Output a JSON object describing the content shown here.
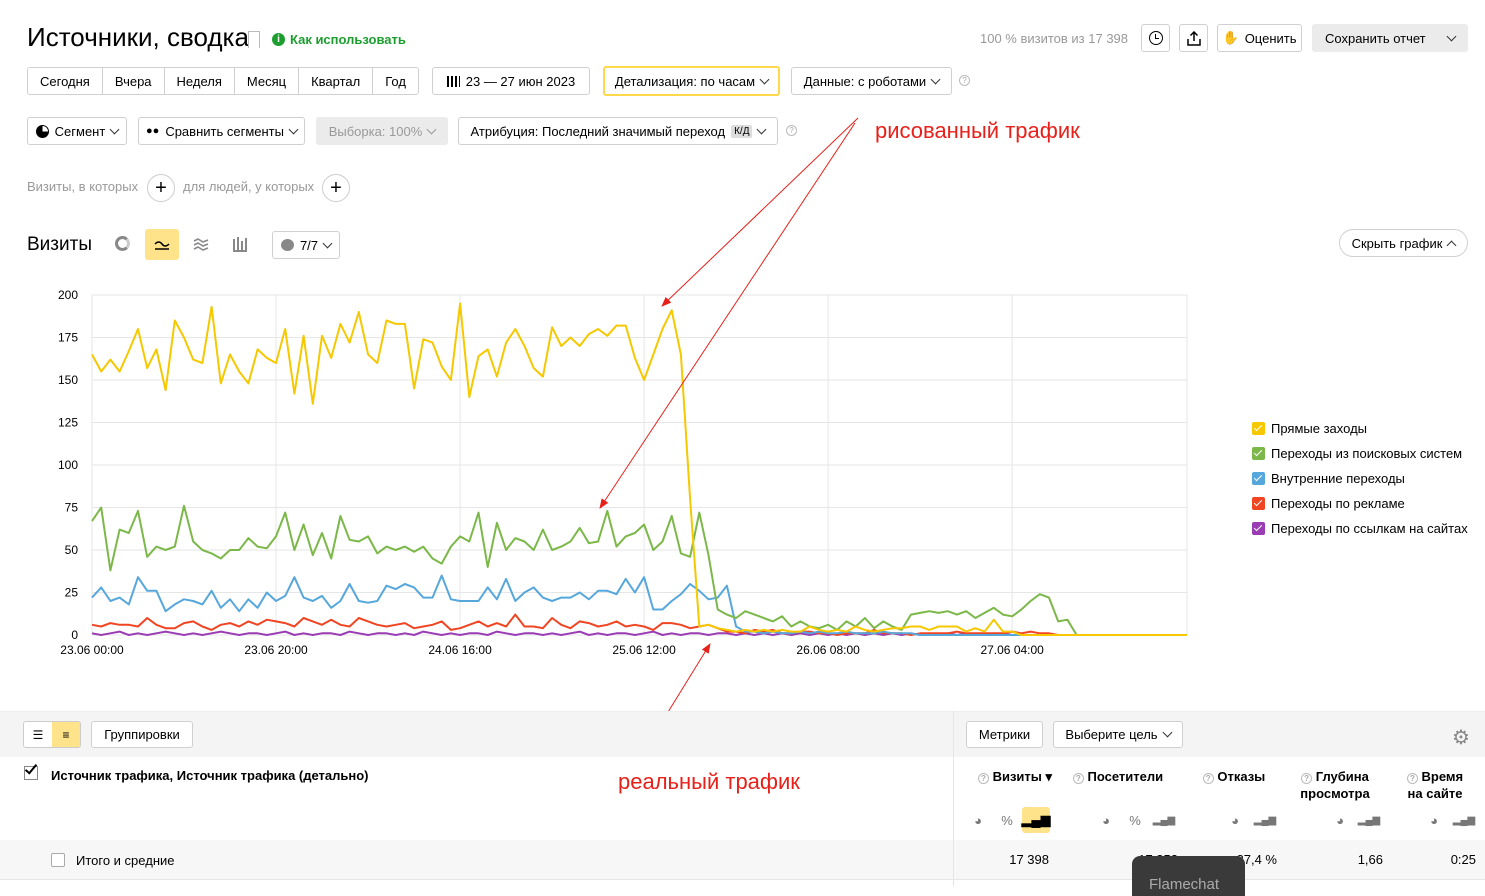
{
  "header": {
    "title": "Источники, сводка",
    "how_to": "Как использовать",
    "visits_info": "100 % визитов из 17 398",
    "rate_label": "Оценить",
    "save_label": "Сохранить отчет"
  },
  "periods": [
    "Сегодня",
    "Вчера",
    "Неделя",
    "Месяц",
    "Квартал",
    "Год"
  ],
  "date_range": "23 — 27 июн 2023",
  "detail": "Детализация: по часам",
  "data_mode": "Данные: с роботами",
  "segment": "Сегмент",
  "compare": "Сравнить сегменты",
  "sample": "Выборка: 100%",
  "attribution": "Атрибуция: Последний значимый переход",
  "attribution_badge": "К/Д",
  "filter": {
    "visits": "Визиты, в которых",
    "people": "для людей, у которых"
  },
  "chart_header": {
    "title": "Визиты",
    "counter": "7/7",
    "hide": "Скрыть график"
  },
  "annotations": {
    "drawn": "рисованный трафик",
    "real": "реальный трафик"
  },
  "chart_data": {
    "type": "line",
    "ylim": [
      0,
      200
    ],
    "yticks": [
      "200",
      "175",
      "150",
      "125",
      "100",
      "75",
      "50",
      "25",
      "0"
    ],
    "xticks": [
      "23.06 00:00",
      "23.06 20:00",
      "24.06 16:00",
      "25.06 12:00",
      "26.06 08:00",
      "27.06 04:00"
    ],
    "x_unit": "hours from 23.06 00:00",
    "xlim": [
      0,
      119
    ],
    "series": [
      {
        "name": "Прямые заходы",
        "color": "#f5c800",
        "values": [
          165,
          155,
          162,
          155,
          167,
          180,
          157,
          168,
          144,
          185,
          175,
          162,
          160,
          193,
          148,
          165,
          155,
          148,
          168,
          163,
          160,
          180,
          142,
          176,
          136,
          176,
          163,
          183,
          172,
          190,
          165,
          160,
          185,
          183,
          183,
          145,
          174,
          172,
          158,
          150,
          195,
          140,
          164,
          168,
          152,
          172,
          180,
          170,
          157,
          152,
          181,
          170,
          175,
          170,
          177,
          180,
          176,
          182,
          182,
          163,
          150,
          165,
          180,
          191,
          165,
          80,
          5,
          6,
          4,
          3,
          2,
          3,
          2,
          3,
          2,
          3,
          2,
          2,
          5,
          3,
          2,
          3,
          2,
          5,
          3,
          2,
          3,
          4,
          4,
          5,
          5,
          3,
          5,
          5,
          5,
          2,
          4,
          2,
          9,
          2,
          2,
          0,
          0,
          0,
          0,
          0,
          0,
          0,
          0,
          0,
          0,
          0,
          0,
          0,
          0,
          0,
          0,
          0,
          0,
          0
        ]
      },
      {
        "name": "Переходы из поисковых систем",
        "color": "#7cb849",
        "values": [
          67,
          75,
          38,
          62,
          60,
          73,
          46,
          52,
          50,
          52,
          76,
          55,
          50,
          48,
          45,
          50,
          50,
          57,
          52,
          51,
          58,
          72,
          50,
          65,
          47,
          60,
          45,
          70,
          56,
          55,
          58,
          48,
          52,
          50,
          52,
          49,
          52,
          45,
          42,
          52,
          58,
          55,
          72,
          40,
          66,
          50,
          57,
          55,
          50,
          62,
          50,
          52,
          55,
          63,
          54,
          55,
          73,
          52,
          58,
          60,
          65,
          50,
          55,
          70,
          48,
          46,
          72,
          47,
          15,
          12,
          10,
          14,
          12,
          10,
          8,
          11,
          5,
          8,
          5,
          4,
          6,
          3,
          8,
          5,
          10,
          4,
          8,
          5,
          3,
          12,
          13,
          14,
          13,
          14,
          12,
          14,
          10,
          13,
          16,
          12,
          11,
          15,
          20,
          24,
          22,
          8,
          9,
          0,
          0,
          0,
          0,
          0,
          0,
          0,
          0,
          0,
          0,
          0,
          0,
          0
        ]
      },
      {
        "name": "Внутренние переходы",
        "color": "#56a7dc",
        "values": [
          22,
          28,
          20,
          22,
          18,
          34,
          26,
          26,
          14,
          18,
          21,
          20,
          18,
          26,
          16,
          21,
          14,
          21,
          16,
          25,
          20,
          23,
          34,
          22,
          20,
          23,
          16,
          20,
          30,
          20,
          19,
          20,
          29,
          27,
          30,
          28,
          22,
          22,
          35,
          21,
          20,
          20,
          20,
          28,
          21,
          33,
          20,
          25,
          28,
          22,
          20,
          22,
          22,
          25,
          21,
          26,
          26,
          24,
          33,
          25,
          34,
          15,
          15,
          20,
          24,
          30,
          26,
          21,
          22,
          29,
          5,
          2,
          2,
          1,
          2,
          1,
          1,
          2,
          1,
          2,
          1,
          1,
          2,
          1,
          1,
          1,
          2,
          1,
          1,
          1,
          0,
          0,
          0,
          0,
          0,
          0,
          0,
          0,
          0,
          0,
          0,
          0,
          0,
          0,
          0,
          0,
          0,
          0,
          0,
          0,
          0,
          0,
          0,
          0,
          0,
          0,
          0,
          0,
          0,
          0
        ]
      },
      {
        "name": "Переходы по рекламе",
        "color": "#f04523",
        "values": [
          6,
          5,
          7,
          6,
          6,
          5,
          10,
          6,
          4,
          4,
          7,
          8,
          5,
          3,
          6,
          7,
          5,
          8,
          6,
          9,
          8,
          7,
          5,
          10,
          8,
          6,
          9,
          6,
          5,
          10,
          8,
          6,
          5,
          6,
          7,
          4,
          5,
          6,
          8,
          3,
          4,
          6,
          8,
          5,
          7,
          5,
          12,
          5,
          5,
          4,
          10,
          6,
          4,
          8,
          7,
          5,
          6,
          8,
          5,
          6,
          5,
          3,
          7,
          7,
          6,
          4,
          5,
          6,
          4,
          2,
          2,
          1,
          3,
          2,
          3,
          1,
          1,
          2,
          2,
          1,
          1,
          0,
          1,
          1,
          1,
          3,
          1,
          1,
          1,
          0,
          1,
          1,
          1,
          1,
          2,
          1,
          1,
          1,
          1,
          1,
          2,
          1,
          2,
          1,
          1,
          0,
          0,
          0,
          0,
          0,
          0,
          0,
          0,
          0,
          0,
          0,
          0,
          0,
          0,
          0
        ]
      },
      {
        "name": "Переходы по ссылкам на сайтах",
        "color": "#9a3cb4",
        "values": [
          1,
          0,
          1,
          2,
          0,
          1,
          0,
          1,
          2,
          1,
          0,
          1,
          0,
          1,
          2,
          1,
          0,
          1,
          1,
          0,
          1,
          2,
          0,
          1,
          0,
          1,
          1,
          0,
          2,
          1,
          0,
          1,
          1,
          0,
          1,
          0,
          2,
          1,
          0,
          1,
          0,
          1,
          1,
          0,
          2,
          1,
          0,
          1,
          1,
          0,
          1,
          0,
          1,
          2,
          0,
          1,
          0,
          1,
          1,
          0,
          1,
          2,
          0,
          1,
          0,
          1,
          1,
          0,
          1,
          1,
          0,
          1,
          0,
          1,
          0,
          1,
          0,
          1,
          0,
          1,
          0,
          1,
          0,
          1,
          0,
          1,
          0,
          1,
          0,
          1,
          0,
          1,
          0,
          1,
          0,
          1,
          0,
          1,
          0,
          1,
          0,
          0,
          0,
          0,
          0,
          0,
          0,
          0,
          0,
          0,
          0,
          0,
          0,
          0,
          0,
          0,
          0,
          0,
          0,
          0
        ]
      }
    ]
  },
  "table": {
    "groupings": "Группировки",
    "metrics": "Метрики",
    "goal": "Выберите цель",
    "dimension": "Источник трафика, Источник трафика (детально)",
    "columns": [
      "Визиты",
      "Посетители",
      "Отказы",
      "Глубина просмотра",
      "Время на сайте"
    ],
    "total_label": "Итого и средние",
    "totals": [
      "17 398",
      "17 352",
      "27,4 %",
      "1,66",
      "0:25"
    ],
    "flamechat": "Flamechat"
  }
}
